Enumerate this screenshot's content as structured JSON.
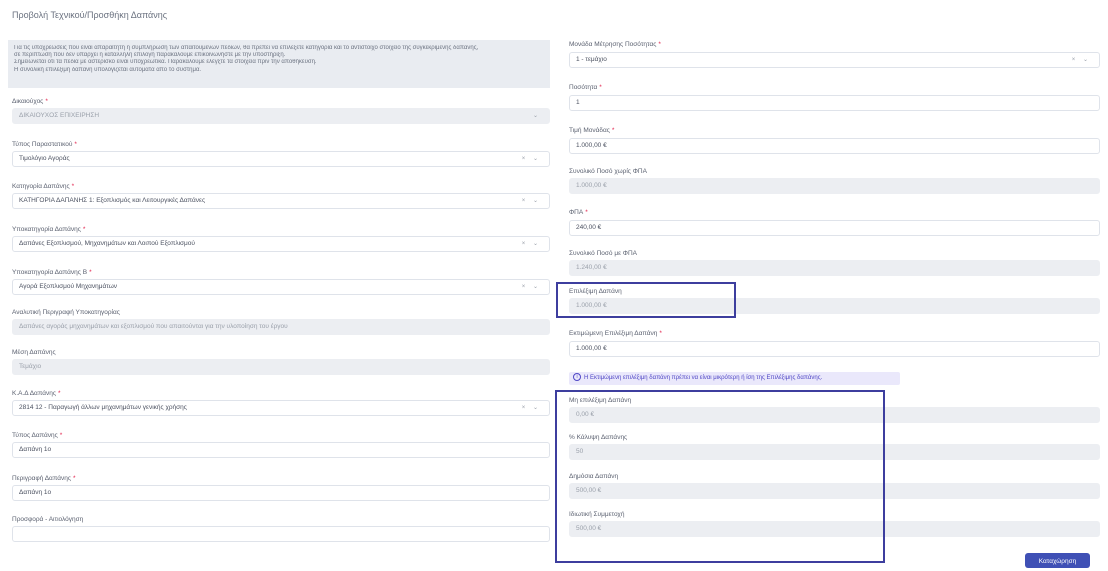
{
  "page": {
    "title": "Προβολή Τεχνικού/Προσθήκη Δαπάνης"
  },
  "notice": {
    "lines": [
      "Για τις υποχρεώσεις που είναι απαραίτητη η συμπλήρωση των απαιτούμενων πεδίων, θα πρέπει να επιλέξετε κατηγορία και το αντίστοιχο στοιχείο της συγκεκριμένης δαπάνης,",
      "σε περίπτωση που δεν υπάρχει η κατάλληλη επιλογή παρακαλούμε επικοινωνήστε με την υποστήριξη.",
      "Σημειώνεται ότι τα πεδία με αστερίσκο είναι υποχρεωτικά. Παρακαλούμε ελέγξτε τα στοιχεία πριν την αποθήκευση.",
      "Η συνολική επιλέξιμη δαπάνη υπολογίζεται αυτόματα από το σύστημα."
    ]
  },
  "left": {
    "fields": [
      {
        "label": "Δικαιούχος",
        "required": true,
        "value": "ΔΙΚΑΙΟΥΧΟΣ ΕΠΙΧΕΙΡΗΣΗ",
        "readonly": true,
        "select": false
      },
      {
        "label": "Τύπος Παραστατικού",
        "required": true,
        "value": "Τιμολόγιο Αγοράς",
        "readonly": false,
        "select": true
      },
      {
        "label": "Κατηγορία Δαπάνης",
        "required": true,
        "value": "ΚΑΤΗΓΟΡΙΑ ΔΑΠΑΝΗΣ 1: Εξοπλισμός και Λειτουργικές Δαπάνες",
        "readonly": false,
        "select": true
      },
      {
        "label": "Υποκατηγορία Δαπάνης",
        "required": true,
        "value": "Δαπάνες Εξοπλισμού, Μηχανημάτων και Λοιπού Εξοπλισμού",
        "readonly": false,
        "select": true
      },
      {
        "label": "Υποκατηγορία Δαπάνης Β",
        "required": true,
        "value": "Αγορά Εξοπλισμού Μηχανημάτων",
        "readonly": false,
        "select": true
      },
      {
        "label": "Αναλυτική Περιγραφή Υποκατηγορίας",
        "required": false,
        "value": "Δαπάνες αγοράς μηχανημάτων και εξοπλισμού που απαιτούνται για την υλοποίηση του έργου",
        "readonly": true,
        "select": false
      },
      {
        "label": "Μέση Δαπάνης",
        "required": false,
        "value": "Τεμάχιο",
        "readonly": true,
        "select": false
      },
      {
        "label": "Κ.Α.Δ Δαπάνης",
        "required": true,
        "value": "2814 12 - Παραγωγή άλλων μηχανημάτων γενικής χρήσης",
        "readonly": false,
        "select": true
      },
      {
        "label": "Τύπος Δαπάνης",
        "required": true,
        "value": "Δαπάνη 1ο",
        "readonly": false,
        "select": false
      },
      {
        "label": "Περιγραφή Δαπάνης",
        "required": true,
        "value": "Δαπάνη 1ο",
        "readonly": false,
        "select": false
      },
      {
        "label": "Προσφορά - Αιτιολόγηση",
        "required": false,
        "value": "",
        "readonly": false,
        "select": false
      }
    ]
  },
  "right": {
    "fields": [
      {
        "label": "Μονάδα Μέτρησης Ποσότητας",
        "required": true,
        "value": "1 - τεμάχιο",
        "readonly": false,
        "select": true
      },
      {
        "label": "Ποσότητα",
        "required": true,
        "value": "1",
        "readonly": false,
        "select": false
      },
      {
        "label": "Τιμή Μονάδας",
        "required": true,
        "value": "1.000,00 €",
        "readonly": false,
        "select": false
      },
      {
        "label": "Συνολικό Ποσό χωρίς ΦΠΑ",
        "required": false,
        "value": "1.000,00 €",
        "readonly": true,
        "select": false
      },
      {
        "label": "ΦΠΑ",
        "required": true,
        "value": "240,00 €",
        "readonly": false,
        "select": false
      },
      {
        "label": "Συνολικό Ποσό με ΦΠΑ",
        "required": false,
        "value": "1.240,00 €",
        "readonly": true,
        "select": false
      },
      {
        "label": "Επιλέξιμη Δαπάνη",
        "required": false,
        "value": "1.000,00 €",
        "readonly": true,
        "select": false
      },
      {
        "label": "Εκτιμώμενη Επιλέξιμη Δαπάνη",
        "required": true,
        "value": "1.000,00 €",
        "readonly": false,
        "select": false
      },
      {
        "label": "Μη επιλέξιμη Δαπάνη",
        "required": false,
        "value": "0,00 €",
        "readonly": true,
        "select": false
      },
      {
        "label": "% Κάλυψη Δαπάνης",
        "required": false,
        "value": "50",
        "readonly": true,
        "select": false
      },
      {
        "label": "Δημόσια Δαπάνη",
        "required": false,
        "value": "500,00 €",
        "readonly": true,
        "select": false
      },
      {
        "label": "Ιδιωτική Συμμετοχή",
        "required": false,
        "value": "500,00 €",
        "readonly": true,
        "select": false
      }
    ],
    "info_text": "Η Εκτιμώμενη επιλέξιμη δαπάνη πρέπει να είναι μικρότερη ή ίση της Επιλέξιμης δαπάνης."
  },
  "actions": {
    "save_label": "Καταχώρηση"
  },
  "colors": {
    "accent": "#3f50b5",
    "highlight_border": "#3d3e9e",
    "info_bg": "#eae8fb"
  }
}
